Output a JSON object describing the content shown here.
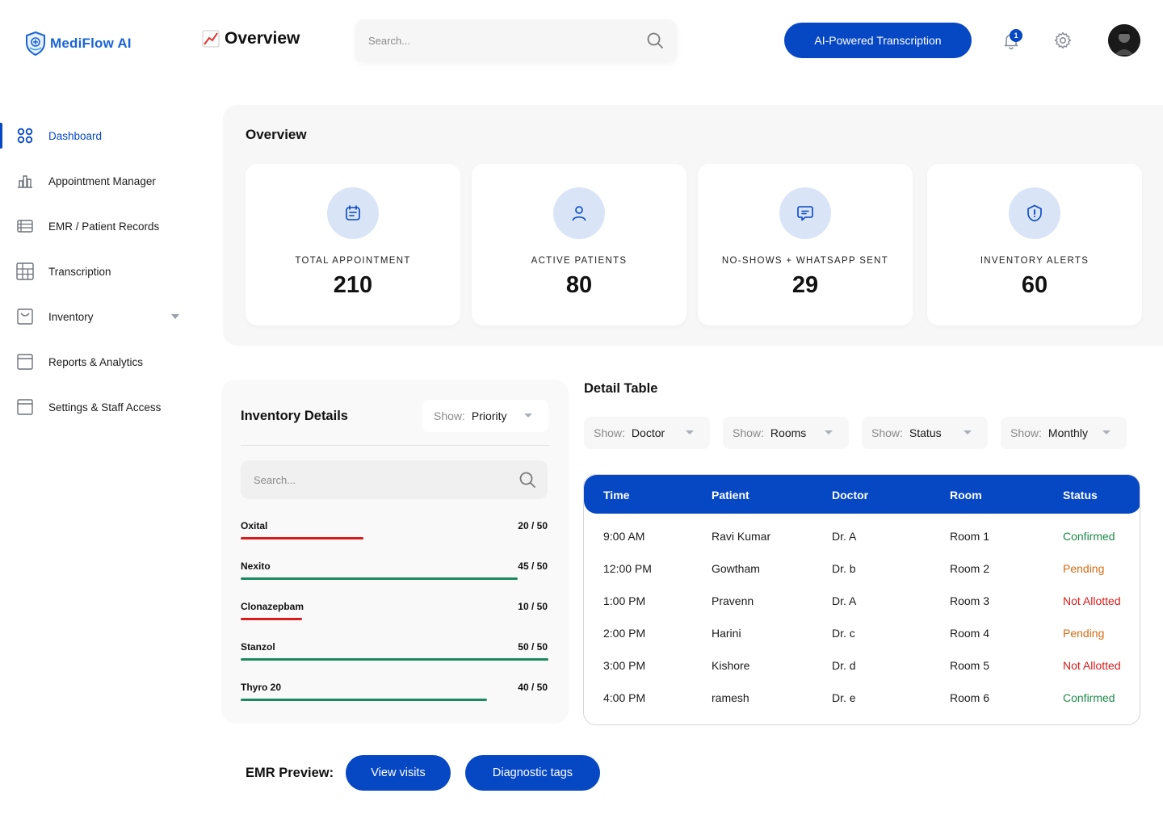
{
  "app": {
    "name": "MediFlow  AI"
  },
  "header": {
    "page_title": "Overview",
    "search_placeholder": "Search...",
    "ai_button": "AI-Powered Transcription",
    "notification_count": "1"
  },
  "sidebar": {
    "items": [
      {
        "label": "Dashboard",
        "icon": "dashboard-grid-icon",
        "active": true
      },
      {
        "label": "Appointment Manager",
        "icon": "chart-bars-icon"
      },
      {
        "label": "EMR / Patient Records",
        "icon": "records-list-icon"
      },
      {
        "label": "Transcription",
        "icon": "table-grid-icon"
      },
      {
        "label": "Inventory",
        "icon": "inventory-box-icon"
      },
      {
        "label": "Reports & Analytics",
        "icon": "report-window-icon"
      },
      {
        "label": "Settings & Staff Access",
        "icon": "settings-window-icon"
      }
    ]
  },
  "overview": {
    "title": "Overview",
    "cards": [
      {
        "label": "Total Appointment",
        "value": "210",
        "icon": "calendar-icon"
      },
      {
        "label": "Active Patients",
        "value": "80",
        "icon": "user-icon"
      },
      {
        "label": "No-Shows + WhatsApp Sent",
        "value": "29",
        "icon": "message-icon"
      },
      {
        "label": "Inventory Alerts",
        "value": "60",
        "icon": "alert-shield-icon"
      }
    ]
  },
  "inventory": {
    "title": "Inventory Details",
    "show_label": "Show:",
    "show_value": "Priority",
    "search_placeholder": "Search...",
    "items": [
      {
        "name": "Oxital",
        "count": "20 / 50",
        "level": 0.4,
        "color": "#d81b1b"
      },
      {
        "name": "Nexito",
        "count": "45 / 50",
        "level": 0.9,
        "color": "#1c8a60"
      },
      {
        "name": "Clonazepbam",
        "count": "10 / 50",
        "level": 0.2,
        "color": "#d81b1b"
      },
      {
        "name": "Stanzol",
        "count": "50 / 50",
        "level": 1.0,
        "color": "#1c8a60"
      },
      {
        "name": "Thyro 20",
        "count": "40 / 50",
        "level": 0.8,
        "color": "#1c8a60"
      }
    ]
  },
  "detail_table": {
    "title": "Detail Table",
    "filters": [
      {
        "label": "Show:",
        "value": "Doctor"
      },
      {
        "label": "Show:",
        "value": "Rooms"
      },
      {
        "label": "Show:",
        "value": "Status"
      },
      {
        "label": "Show:",
        "value": "Monthly"
      }
    ],
    "columns": [
      "Time",
      "Patient",
      "Doctor",
      "Room",
      "Status"
    ],
    "rows": [
      {
        "time": "9:00 AM",
        "patient": "Ravi Kumar",
        "doctor": "Dr. A",
        "room": "Room 1",
        "status": "Confirmed"
      },
      {
        "time": "12:00 PM",
        "patient": "Gowtham",
        "doctor": "Dr. b",
        "room": "Room 2",
        "status": "Pending"
      },
      {
        "time": "1:00 PM",
        "patient": "Pravenn",
        "doctor": "Dr. A",
        "room": "Room 3",
        "status": "Not Allotted"
      },
      {
        "time": "2:00 PM",
        "patient": "Harini",
        "doctor": "Dr. c",
        "room": "Room 4",
        "status": "Pending"
      },
      {
        "time": "3:00 PM",
        "patient": "Kishore",
        "doctor": "Dr. d",
        "room": "Room 5",
        "status": "Not Allotted"
      },
      {
        "time": "4:00 PM",
        "patient": "ramesh",
        "doctor": "Dr. e",
        "room": "Room 6",
        "status": "Confirmed"
      }
    ]
  },
  "emr": {
    "label": "EMR Preview:",
    "buttons": [
      "View visits",
      "Diagnostic tags"
    ]
  },
  "colors": {
    "accent": "#0647c4",
    "confirmed": "#1c8a48",
    "pending": "#d86a10",
    "not_allotted": "#d81b1b"
  }
}
